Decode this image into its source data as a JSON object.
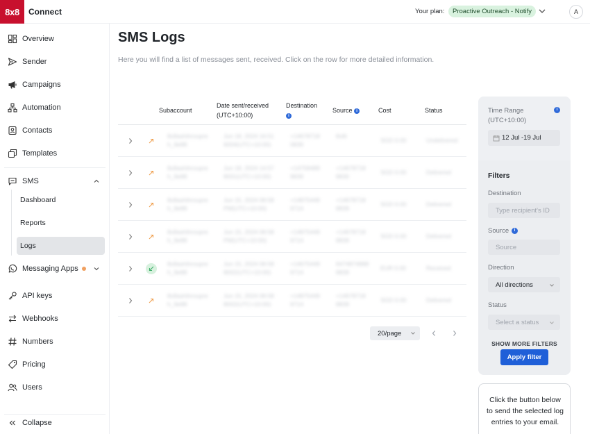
{
  "topbar": {
    "logo": "8x8",
    "brand": "Connect",
    "plan_label": "Your plan:",
    "plan_name": "Proactive Outreach - Notify",
    "avatar": "A"
  },
  "sidebar": {
    "items": [
      {
        "label": "Overview",
        "icon": "overview-icon"
      },
      {
        "label": "Sender",
        "icon": "send-icon"
      },
      {
        "label": "Campaigns",
        "icon": "megaphone-icon"
      },
      {
        "label": "Automation",
        "icon": "automation-icon"
      },
      {
        "label": "Contacts",
        "icon": "contacts-icon"
      },
      {
        "label": "Templates",
        "icon": "templates-icon"
      },
      {
        "label": "SMS",
        "icon": "chat-icon"
      },
      {
        "label": "Messaging Apps",
        "icon": "whatsapp-icon"
      },
      {
        "label": "API keys",
        "icon": "key-icon"
      },
      {
        "label": "Webhooks",
        "icon": "webhooks-icon"
      },
      {
        "label": "Numbers",
        "icon": "hash-icon"
      },
      {
        "label": "Pricing",
        "icon": "tag-icon"
      },
      {
        "label": "Users",
        "icon": "users-icon"
      }
    ],
    "sms_sub": [
      "Dashboard",
      "Reports",
      "Logs"
    ],
    "collapse": "Collapse"
  },
  "main": {
    "title": "SMS Logs",
    "description": "Here you will find a list of messages sent, received. Click on the row for more detailed information.",
    "columns": {
      "subaccount": "Subaccount",
      "date_line1": "Date sent/received",
      "date_line2": "(UTC+10:00)",
      "destination": "Destination",
      "source": "Source",
      "cost": "Cost",
      "status": "Status"
    },
    "rows": [
      {
        "direction": "outbound",
        "sub1": "8x8ashihroupre",
        "sub2": "h_9e88",
        "date1": "Jun 18, 2024 16:51",
        "date2": "6004(UTC+10:00)",
        "dest1": "+14678718",
        "dest2": "0839",
        "src1": "8x8i",
        "src2": "",
        "cost": "SGD 0.00",
        "status": "Undelivered"
      },
      {
        "direction": "outbound",
        "sub1": "8x8ashihroupre",
        "sub2": "h_9e88",
        "date1": "Jun 18, 2024 14:57",
        "date2": "8001(UTC+10:00)",
        "dest1": "+14758489",
        "dest2": "9839",
        "src1": "+14678718",
        "src2": "8830",
        "cost": "SGD 0.00",
        "status": "Delivered"
      },
      {
        "direction": "outbound",
        "sub1": "8x8ashihroupre",
        "sub2": "h_9e88",
        "date1": "Jun 15, 2024 08:58",
        "date2": "PM(UTC+10:00)",
        "dest1": "+14875449",
        "dest2": "9714",
        "src1": "+14678718",
        "src2": "8839",
        "cost": "SGD 0.00",
        "status": "Delivered"
      },
      {
        "direction": "outbound",
        "sub1": "8x8ashihroupre",
        "sub2": "h_9e88",
        "date1": "Jun 15, 2024 08:58",
        "date2": "PM(UTC+10:00)",
        "dest1": "+14875449",
        "dest2": "9714",
        "src1": "+14678718",
        "src2": "8839",
        "cost": "SGD 0.00",
        "status": "Delivered"
      },
      {
        "direction": "inbound",
        "sub1": "8x8ashihroupre",
        "sub2": "h_9e88",
        "date1": "Jun 15, 2024 08:58",
        "date2": "8002(UTC+10:00)",
        "dest1": "+14675449",
        "dest2": "9714",
        "src1": "6474874888",
        "src2": "8839",
        "cost": "EUR 0.00",
        "status": "Received"
      },
      {
        "direction": "outbound",
        "sub1": "8x8ashihroupre",
        "sub2": "h_9e88",
        "date1": "Jun 15, 2024 08:58",
        "date2": "8002(UTC+10:00)",
        "dest1": "+14875449",
        "dest2": "9714",
        "src1": "+14678718",
        "src2": "8839",
        "cost": "SGD 0.00",
        "status": "Delivered"
      }
    ],
    "page_size": "20/page"
  },
  "filters": {
    "time_range_label_1": "Time Range",
    "time_range_label_2": "(UTC+10:00)",
    "range_start": "12 Jul",
    "range_end": "-19 Jul",
    "title": "Filters",
    "destination_label": "Destination",
    "destination_placeholder": "Type recipient's ID",
    "source_label": "Source",
    "source_placeholder": "Source",
    "direction_label": "Direction",
    "direction_value": "All directions",
    "status_label": "Status",
    "status_placeholder": "Select a status",
    "more_filters": "SHOW MORE FILTERS",
    "apply": "Apply filter"
  },
  "email_card": {
    "text": "Click the button below to send the selected log entries to your email."
  },
  "colors": {
    "brand_red": "#c8102e",
    "primary_blue": "#1f5fd8",
    "plan_badge_bg": "#d9f2df",
    "outbound_arrow": "#f0a050",
    "inbound_arrow": "#3fae6a"
  }
}
